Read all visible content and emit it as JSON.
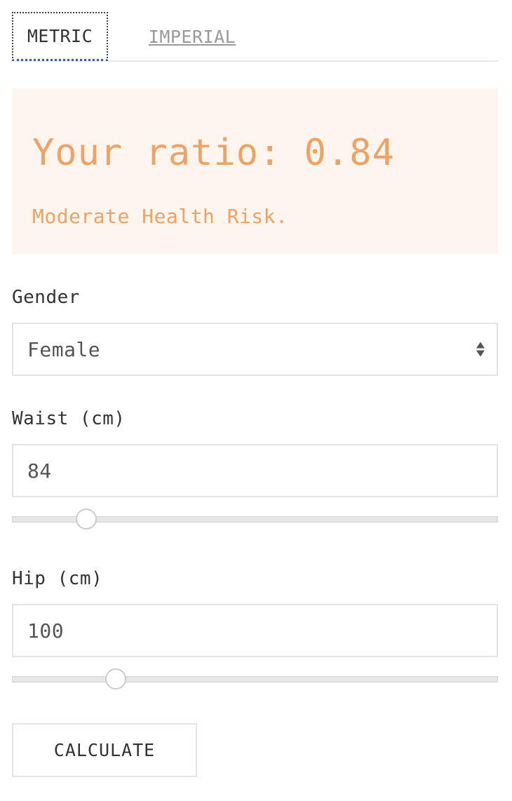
{
  "tabs": {
    "metric_label": "METRIC",
    "imperial_label": "IMPERIAL",
    "active": "metric"
  },
  "result": {
    "title": "Your ratio: 0.84",
    "status": "Moderate Health Risk.",
    "accent_color": "#eea263",
    "background_color": "#fdf5ee"
  },
  "form": {
    "gender": {
      "label": "Gender",
      "value": "Female"
    },
    "waist": {
      "label": "Waist (cm)",
      "value": "84",
      "slider_fraction": 0.153
    },
    "hip": {
      "label": "Hip (cm)",
      "value": "100",
      "slider_fraction": 0.214
    },
    "calculate_label": "CALCULATE"
  }
}
